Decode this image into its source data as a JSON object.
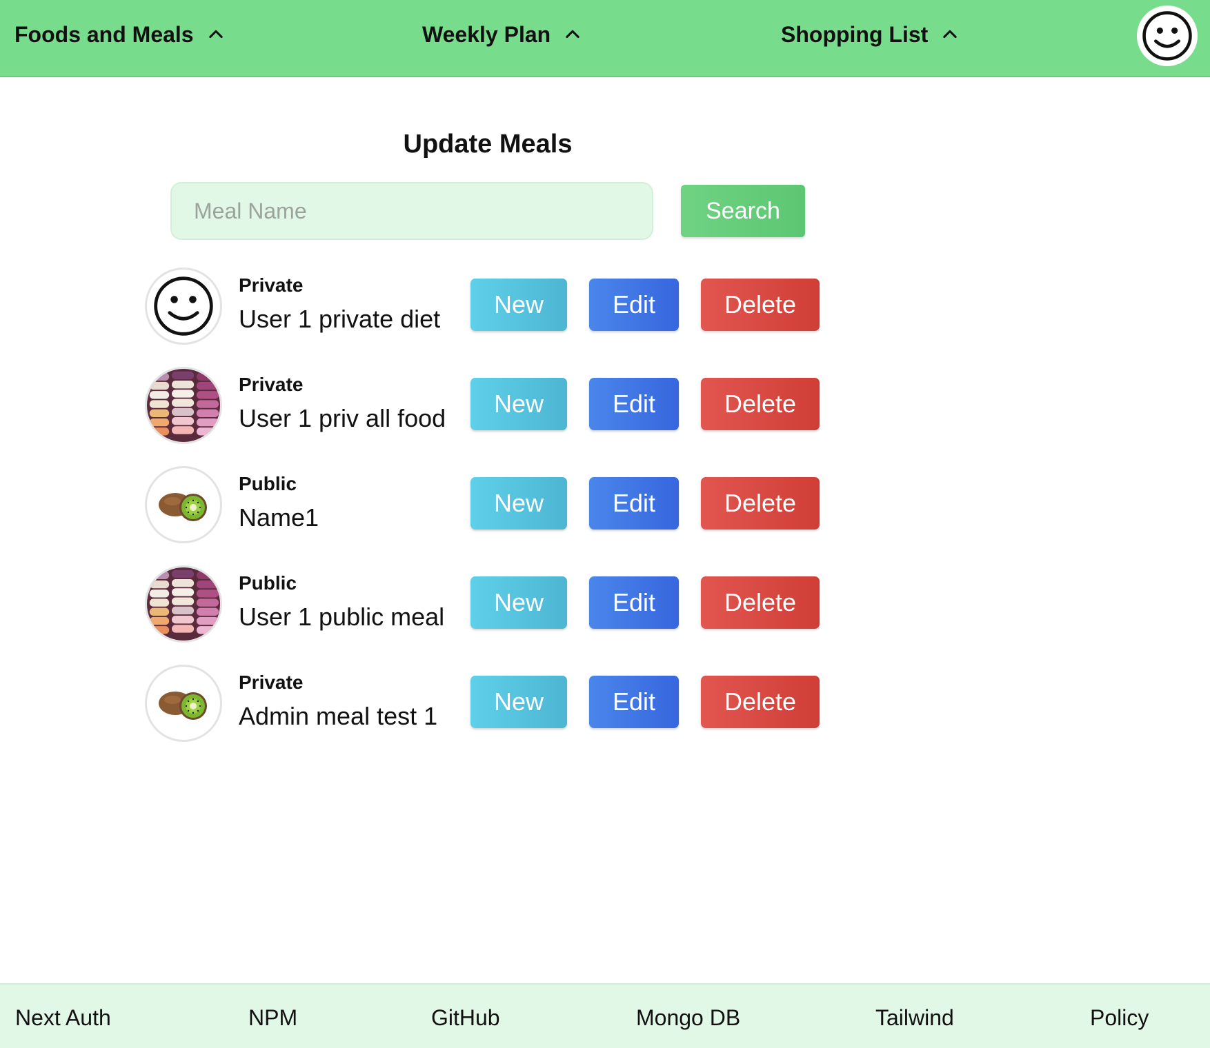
{
  "nav": {
    "items": [
      {
        "label": "Foods and Meals"
      },
      {
        "label": "Weekly Plan"
      },
      {
        "label": "Shopping List"
      }
    ]
  },
  "page": {
    "title": "Update Meals"
  },
  "search": {
    "placeholder": "Meal Name",
    "value": "",
    "button_label": "Search"
  },
  "meals": [
    {
      "visibility": "Private",
      "name": "User 1 private diet",
      "thumbnail": "smiley-icon",
      "new_label": "New",
      "edit_label": "Edit",
      "delete_label": "Delete"
    },
    {
      "visibility": "Private",
      "name": "User 1 priv all food",
      "thumbnail": "macarons-image",
      "new_label": "New",
      "edit_label": "Edit",
      "delete_label": "Delete"
    },
    {
      "visibility": "Public",
      "name": "Name1",
      "thumbnail": "kiwi-image",
      "new_label": "New",
      "edit_label": "Edit",
      "delete_label": "Delete"
    },
    {
      "visibility": "Public",
      "name": "User 1 public meal",
      "thumbnail": "macarons-image",
      "new_label": "New",
      "edit_label": "Edit",
      "delete_label": "Delete"
    },
    {
      "visibility": "Private",
      "name": "Admin meal test 1",
      "thumbnail": "kiwi-image",
      "new_label": "New",
      "edit_label": "Edit",
      "delete_label": "Delete"
    }
  ],
  "footer": {
    "links": [
      {
        "label": "Next Auth"
      },
      {
        "label": "NPM"
      },
      {
        "label": "GitHub"
      },
      {
        "label": "Mongo DB"
      },
      {
        "label": "Tailwind"
      },
      {
        "label": "Policy"
      }
    ]
  },
  "colors": {
    "nav_bg": "#77dc8b",
    "footer_bg": "#e2f8e6",
    "search_btn": "#5cc772",
    "new_btn": "#5fd0ea",
    "edit_btn": "#3f74e4",
    "delete_btn": "#d84740"
  }
}
